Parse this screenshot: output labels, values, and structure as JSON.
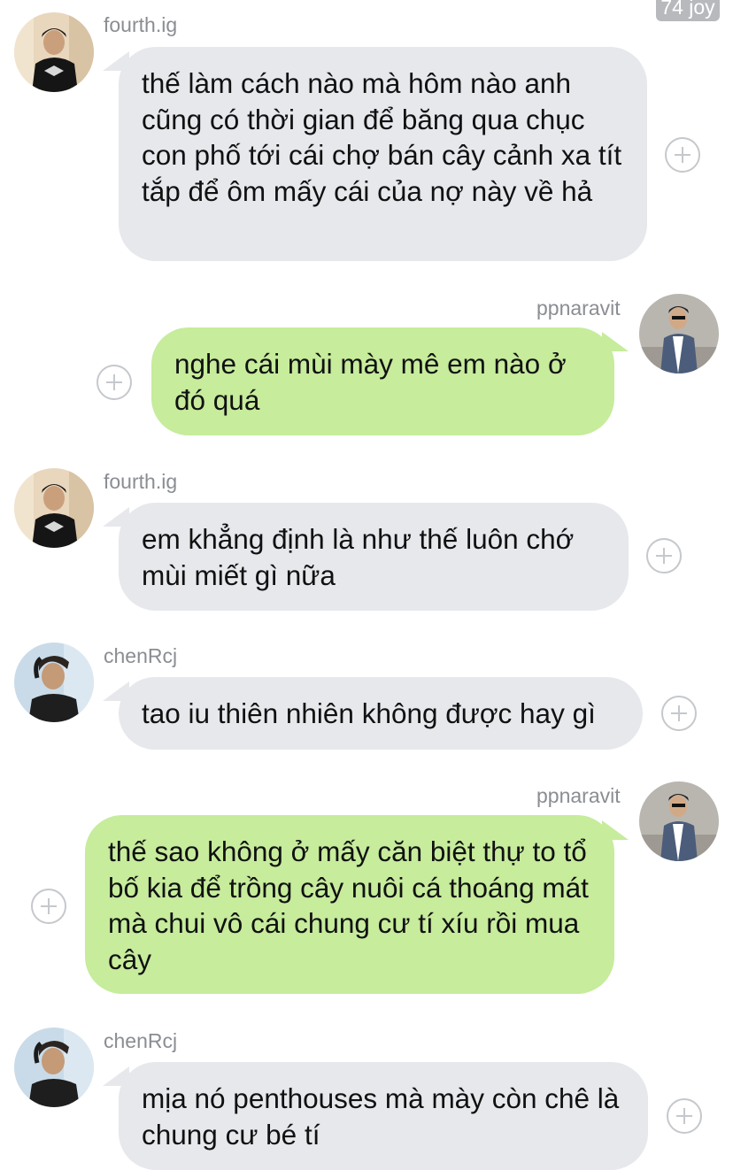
{
  "top_badge": "74 joy",
  "users": {
    "fourth": "fourth.ig",
    "ppnaravit": "ppnaravit",
    "chen": "chenRcj"
  },
  "messages": [
    {
      "sender": "fourth.ig",
      "side": "left",
      "text": "thế làm cách nào mà hôm nào anh cũng có thời gian để băng qua chục con phố tới cái chợ bán cây cảnh xa tít tắp để ôm mấy cái của nợ này về hả"
    },
    {
      "sender": "ppnaravit",
      "side": "right",
      "text": "nghe cái mùi mày mê em nào ở đó quá"
    },
    {
      "sender": "fourth.ig",
      "side": "left",
      "text": "em khẳng định là như thế luôn chớ mùi miết gì nữa"
    },
    {
      "sender": "chenRcj",
      "side": "left",
      "text": "tao iu thiên nhiên không được hay gì"
    },
    {
      "sender": "ppnaravit",
      "side": "right",
      "text": "thế sao không ở mấy căn biệt thự to tổ bố kia để trồng cây nuôi cá thoáng mát mà chui vô cái chung cư tí xíu rồi mua cây"
    },
    {
      "sender": "chenRcj",
      "side": "left",
      "text": "mịa nó penthouses mà mày còn chê là chung cư bé tí"
    }
  ],
  "colors": {
    "incoming_bubble": "#e6e8ec",
    "outgoing_bubble": "#c6ec9c",
    "username": "#8a8d92",
    "plus_icon": "#c5c8cc"
  },
  "icons": {
    "add": "plus-circle-icon"
  }
}
